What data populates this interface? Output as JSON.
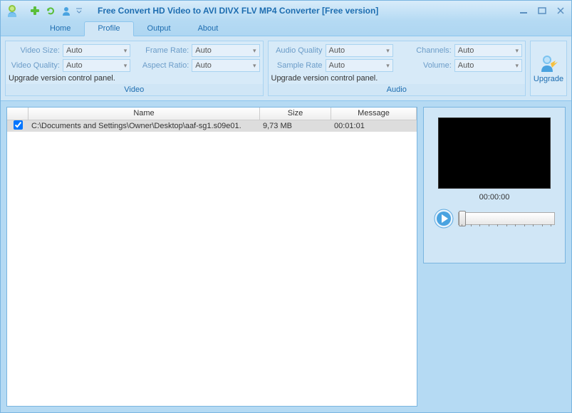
{
  "title": "Free Convert HD Video to AVI DIVX FLV MP4 Converter  [Free version]",
  "tabs": {
    "home": "Home",
    "profile": "Profile",
    "output": "Output",
    "about": "About"
  },
  "video": {
    "size_label": "Video Size:",
    "size_value": "Auto",
    "quality_label": "Video Quality:",
    "quality_value": "Auto",
    "frame_label": "Frame Rate:",
    "frame_value": "Auto",
    "aspect_label": "Aspect Ratio:",
    "aspect_value": "Auto",
    "upgrade": "Upgrade version control panel.",
    "group": "Video"
  },
  "audio": {
    "quality_label": "Audio Quality",
    "quality_value": "Auto",
    "sample_label": "Sample Rate",
    "sample_value": "Auto",
    "channels_label": "Channels:",
    "channels_value": "Auto",
    "volume_label": "Volume:",
    "volume_value": "Auto",
    "upgrade": "Upgrade version control panel.",
    "group": "Audio"
  },
  "upgrade_btn": "Upgrade",
  "table": {
    "h_name": "Name",
    "h_size": "Size",
    "h_msg": "Message",
    "row": {
      "name": "C:\\Documents and Settings\\Owner\\Desktop\\aaf-sg1.s09e01.",
      "size": "9,73 MB",
      "msg": "00:01:01"
    }
  },
  "preview": {
    "time": "00:00:00"
  }
}
